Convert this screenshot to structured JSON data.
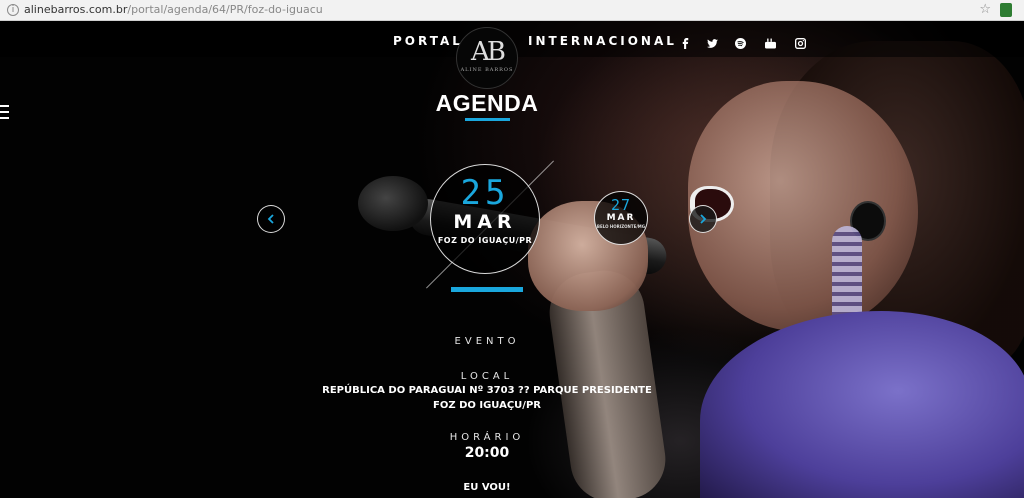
{
  "browser": {
    "url_host": "alinebarros.com.br",
    "url_path": "/portal/agenda/64/PR/foz-do-iguacu",
    "star_icon": "bookmark-star-icon",
    "extension_icon": "extension-icon"
  },
  "nav": {
    "left_link": "PORTAL",
    "right_link": "INTERNACIONAL",
    "logo_monogram": "AB",
    "logo_text": "ALINE BARROS",
    "social": [
      "facebook-icon",
      "twitter-icon",
      "spotify-icon",
      "youtube-icon",
      "instagram-icon"
    ]
  },
  "menu_icon": "hamburger-menu-icon",
  "page": {
    "title": "AGENDA",
    "accent_color": "#1aa7dd"
  },
  "carousel": {
    "current": {
      "day": "25",
      "month": "MAR",
      "city": "FOZ DO IGUAÇU/PR"
    },
    "next": {
      "day": "27",
      "month": "MAR",
      "city": "BELO HORIZONTE/MG"
    },
    "prev_icon": "chevron-left-icon",
    "next_icon": "chevron-right-icon"
  },
  "event": {
    "evento_label": "EVENTO",
    "local_label": "LOCAL",
    "address": "REPÚBLICA DO PARAGUAI Nº 3703 ?? PARQUE PRESIDENTE",
    "city": "FOZ DO IGUAÇU/PR",
    "horario_label": "HORÁRIO",
    "time": "20:00",
    "cta": "EU VOU!"
  }
}
